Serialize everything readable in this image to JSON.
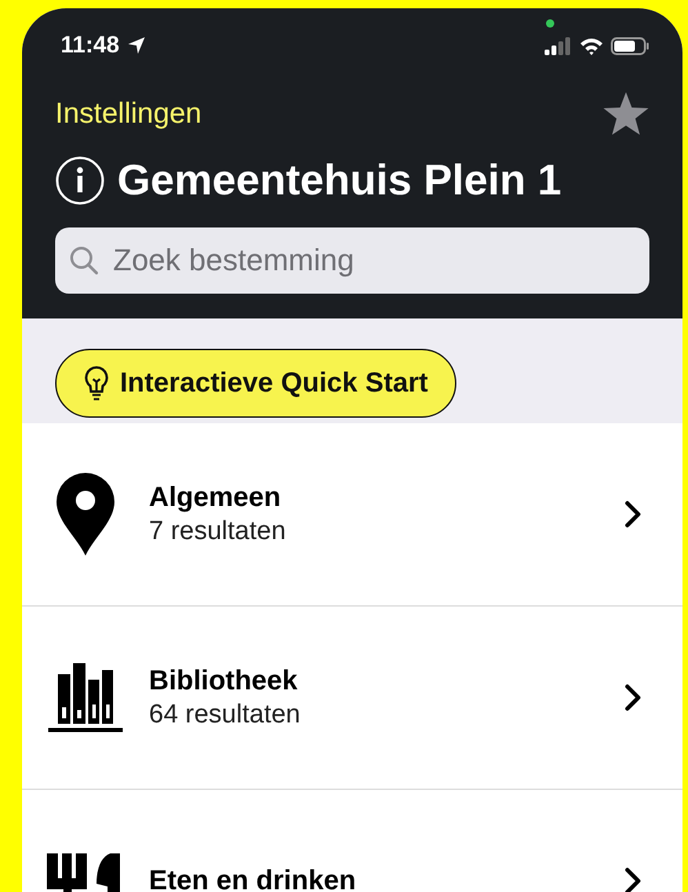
{
  "status_bar": {
    "time": "11:48",
    "location_active": true
  },
  "nav": {
    "back_label": "Instellingen",
    "favorite": false
  },
  "title": "Gemeentehuis Plein 1",
  "search": {
    "placeholder": "Zoek bestemming"
  },
  "quick_start": {
    "label": "Interactieve Quick Start"
  },
  "categories": [
    {
      "kind": "pin",
      "title": "Algemeen",
      "subtitle": "7 resultaten"
    },
    {
      "kind": "books",
      "title": "Bibliotheek",
      "subtitle": "64 resultaten"
    },
    {
      "kind": "dining",
      "title": "Eten en drinken"
    }
  ]
}
